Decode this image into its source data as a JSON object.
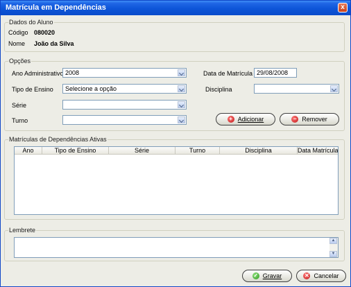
{
  "window": {
    "title": "Matrícula em Dependências",
    "close_glyph": "x"
  },
  "dados_aluno": {
    "legend": "Dados do Aluno",
    "codigo_label": "Código",
    "codigo_value": "080020",
    "nome_label": "Nome",
    "nome_value": "João da Silva"
  },
  "opcoes": {
    "legend": "Opções",
    "ano_label": "Ano Administrativo",
    "ano_value": "2008",
    "tipo_label": "Tipo de Ensino",
    "tipo_value": "Selecione a opção",
    "serie_label": "Série",
    "serie_value": "",
    "turno_label": "Turno",
    "turno_value": "",
    "data_label": "Data de Matrícula",
    "data_value": "29/08/2008",
    "disciplina_label": "Disciplina",
    "disciplina_value": "",
    "adicionar_label": "Adicionar",
    "remover_label": "Remover"
  },
  "matriculas": {
    "legend": "Matrículas de Dependências Ativas",
    "columns": [
      "Ano",
      "Tipo de Ensino",
      "Série",
      "Turno",
      "Disciplina",
      "Data Matrícula"
    ],
    "rows": []
  },
  "lembrete": {
    "legend": "Lembrete",
    "value": ""
  },
  "footer": {
    "gravar_label": "Gravar",
    "cancelar_label": "Cancelar"
  }
}
